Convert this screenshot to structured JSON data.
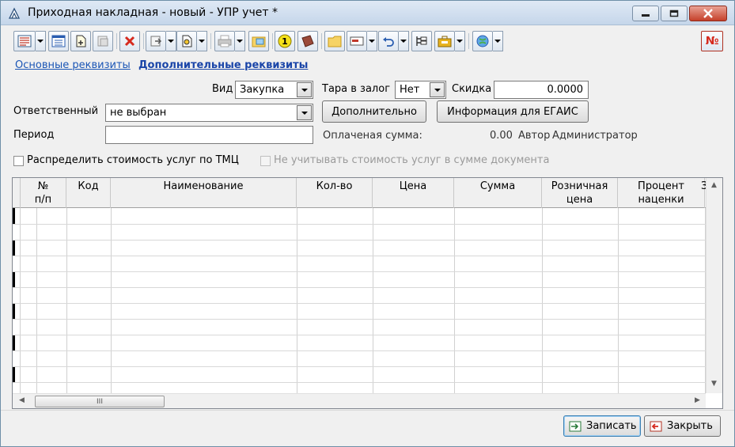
{
  "window": {
    "title": "Приходная накладная - новый - УПР учет *",
    "accent": "#c5d6ea"
  },
  "toolbar": {
    "icons": [
      "list-view-icon",
      "table-icon",
      "new-doc-icon",
      "copy-doc-icon",
      "delete-icon",
      "move-icon",
      "print-preview-icon",
      "printer-icon",
      "folder-image-icon",
      "number-one-icon",
      "book-icon",
      "folder-icon",
      "card-icon",
      "undo-icon",
      "structure-icon",
      "briefcase-icon",
      "globe-icon",
      "number-sign-icon"
    ],
    "number_sign": "№"
  },
  "tabs": {
    "main": "Основные реквизиты",
    "extra": "Дополнительные реквизиты"
  },
  "form": {
    "vid_label": "Вид",
    "vid_value": "Закупка",
    "tara_label": "Тара в залог",
    "tara_value": "Нет",
    "skidka_label": "Скидка",
    "skidka_value": "0.0000",
    "otv_label": "Ответственный",
    "otv_value": "не выбран",
    "dop_button": "Дополнительно",
    "egais_button": "Информация для ЕГАИС",
    "period_label": "Период",
    "period_value": "",
    "paid_label": "Оплаченая сумма:",
    "paid_value": "0.00",
    "author_label": "Автор",
    "author_value": "Администратор",
    "chk_distribute": "Распределить стоимость услуг по ТМЦ",
    "chk_ignore": "Не учитывать стоимость услуг в сумме документа"
  },
  "grid": {
    "columns": [
      {
        "l1": "№",
        "l2": "п/п"
      },
      {
        "l1": "Код",
        "l2": ""
      },
      {
        "l1": "Наименование",
        "l2": ""
      },
      {
        "l1": "Кол-во",
        "l2": ""
      },
      {
        "l1": "Цена",
        "l2": ""
      },
      {
        "l1": "Сумма",
        "l2": ""
      },
      {
        "l1": "Розничная",
        "l2": "цена"
      },
      {
        "l1": "Процент",
        "l2": "наценки"
      },
      {
        "l1": "З",
        "l2": ""
      }
    ],
    "scroll_thumb": "III"
  },
  "footer": {
    "save": "Записать",
    "close": "Закрыть"
  }
}
